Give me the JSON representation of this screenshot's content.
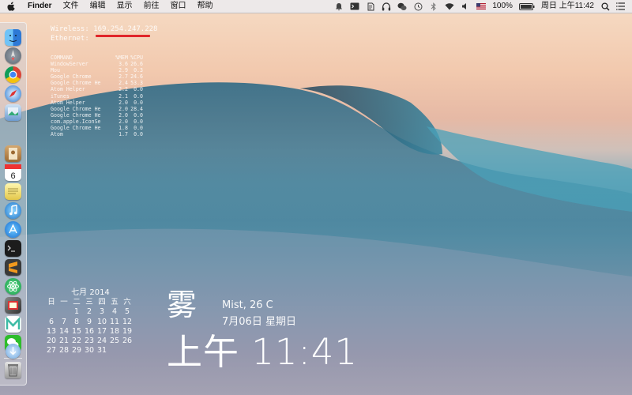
{
  "menubar": {
    "app_name": "Finder",
    "menus": [
      "文件",
      "编辑",
      "显示",
      "前往",
      "窗口",
      "帮助"
    ],
    "battery": "100%",
    "datetime": "周日 上午11:42"
  },
  "network": {
    "wireless_label": "Wireless:",
    "wireless_ip": "169.254.247.228",
    "ethernet_label": "Ethernet:"
  },
  "process_table": {
    "headers": [
      "COMMAND",
      "%MEM",
      "%CPU"
    ],
    "rows": [
      [
        "WindowServer",
        "3.6",
        "26.6"
      ],
      [
        "Mou",
        "2.9",
        "0.3"
      ],
      [
        "Google Chrome",
        "2.7",
        "24.6"
      ],
      [
        "Google Chrome He",
        "2.4",
        "53.3"
      ],
      [
        "Atom Helper",
        "2.2",
        "0.0"
      ],
      [
        "iTunes",
        "2.1",
        "0.0"
      ],
      [
        "Atom Helper",
        "2.0",
        "0.0"
      ],
      [
        "Google Chrome He",
        "2.0",
        "28.4"
      ],
      [
        "Google Chrome He",
        "2.0",
        "0.0"
      ],
      [
        "com.apple.IconSe",
        "2.0",
        "0.0"
      ],
      [
        "Google Chrome He",
        "1.8",
        "0.0"
      ],
      [
        "Atom",
        "1.7",
        "0.0"
      ]
    ]
  },
  "calendar": {
    "title": "七月 2014",
    "weekdays": [
      "日",
      "一",
      "二",
      "三",
      "四",
      "五",
      "六"
    ],
    "days": [
      "",
      "",
      "1",
      "2",
      "3",
      "4",
      "5",
      "6",
      "7",
      "8",
      "9",
      "10",
      "11",
      "12",
      "13",
      "14",
      "15",
      "16",
      "17",
      "18",
      "19",
      "20",
      "21",
      "22",
      "23",
      "24",
      "25",
      "26",
      "27",
      "28",
      "29",
      "30",
      "31",
      "",
      ""
    ]
  },
  "weather": {
    "condition_char": "雾",
    "description": "Mist, 26 C",
    "date": "7月06日 星期日"
  },
  "clock": {
    "time": "上午 11:41"
  },
  "dock_icons": [
    "finder-icon",
    "launchpad-icon",
    "chrome-icon",
    "safari-icon",
    "preview-icon",
    "contacts-icon",
    "calendar-icon",
    "notes-icon",
    "itunes-icon",
    "app-store-icon",
    "terminal-icon",
    "sublime-icon",
    "atom-icon",
    "photo-booth-icon",
    "mou-icon",
    "wechat-icon",
    "downloads-icon",
    "trash-icon"
  ],
  "calendar_dock_day": "6"
}
